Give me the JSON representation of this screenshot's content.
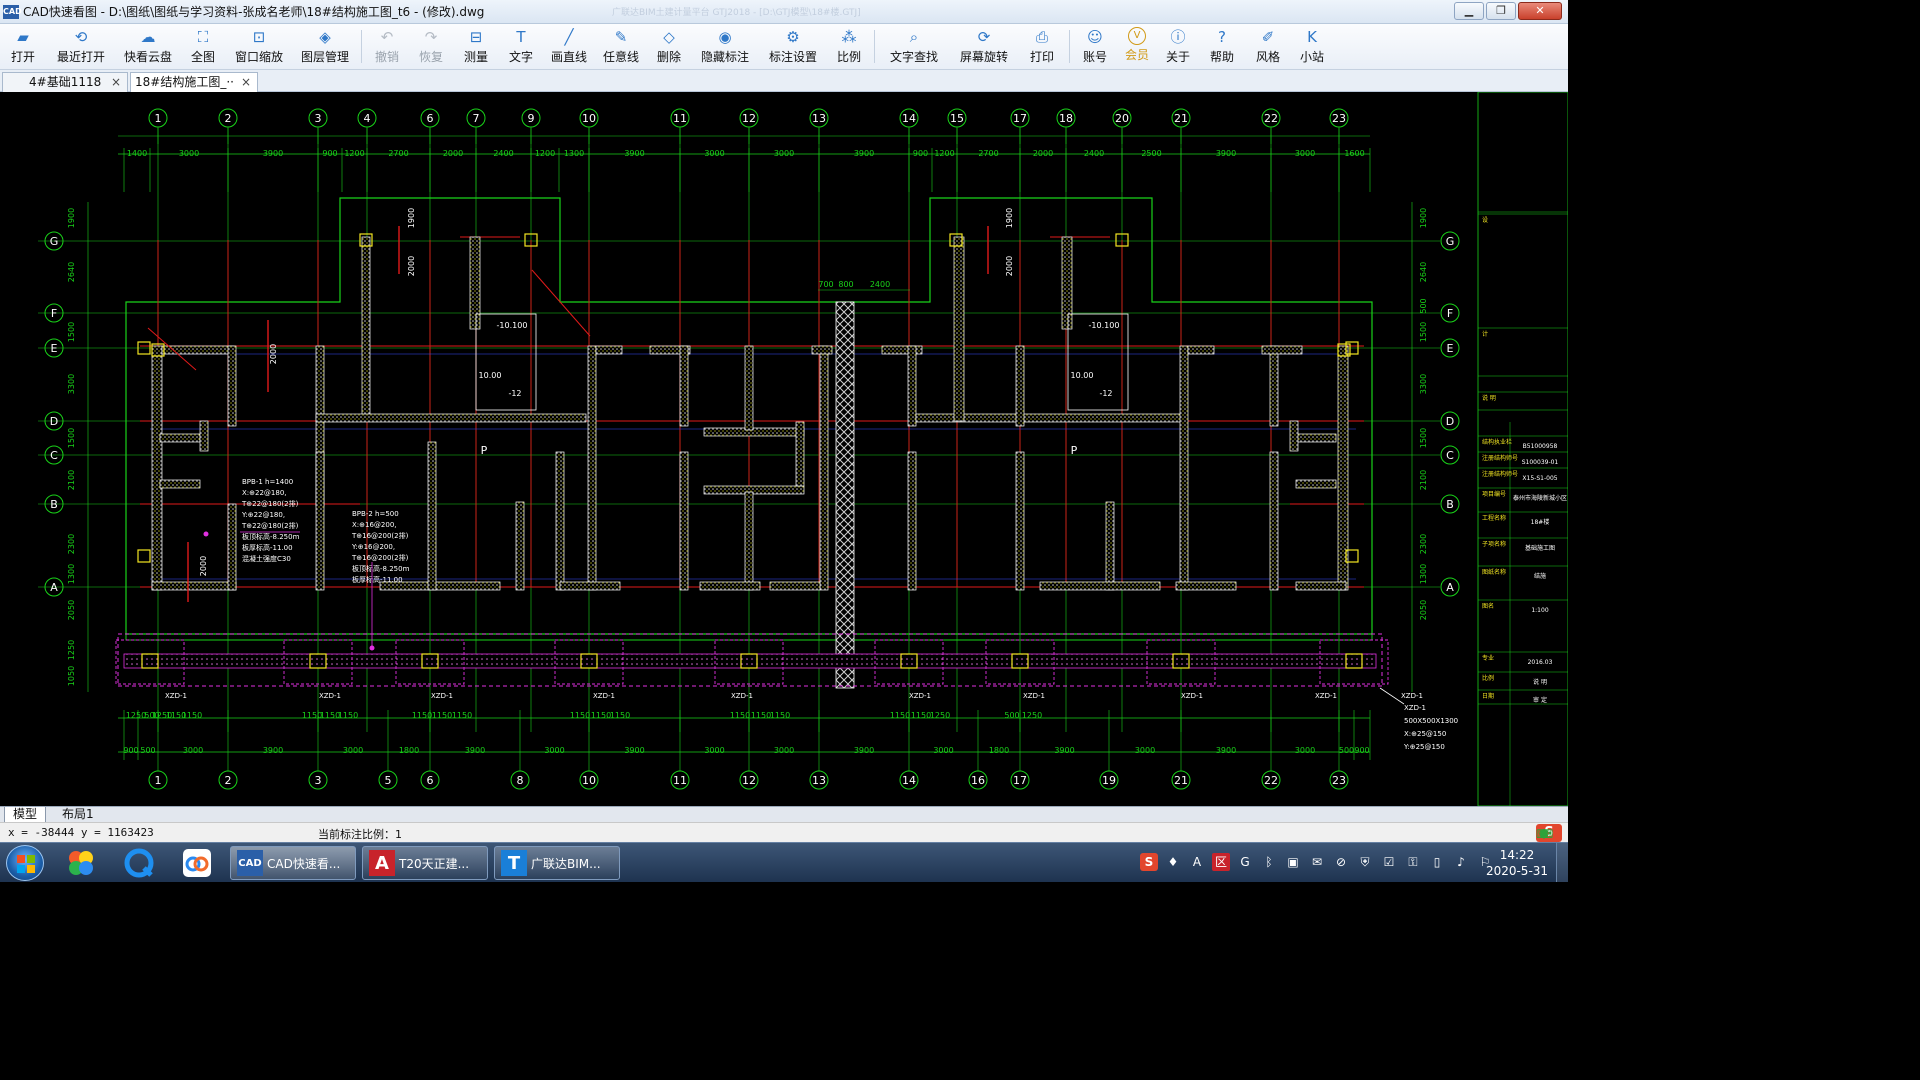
{
  "window": {
    "app_logo": "CAD",
    "title": "CAD快速看图 - D:\\图纸\\图纸与学习资料-张成名老师\\18#结构施工图_t6 - (修改).dwg",
    "faint_title": "广联达BIM土建计量平台 GTJ2018 - [D:\\GTJ模型\\18#楼.GTJ]",
    "minimize": "▁",
    "maximize": "❐",
    "close": "✕"
  },
  "toolbar": {
    "items": [
      {
        "id": "open",
        "label": "打开",
        "icon": "▰",
        "name": "open-folder-icon"
      },
      {
        "id": "recent",
        "label": "最近打开",
        "icon": "⟲",
        "name": "recent-clock-icon"
      },
      {
        "id": "cloud",
        "label": "快看云盘",
        "icon": "☁",
        "name": "cloud-icon"
      },
      {
        "id": "full",
        "label": "全图",
        "icon": "⛶",
        "name": "fullview-icon"
      },
      {
        "id": "zoom",
        "label": "窗口缩放",
        "icon": "⊡",
        "name": "window-zoom-icon"
      },
      {
        "id": "layers",
        "label": "图层管理",
        "icon": "◈",
        "name": "layers-icon",
        "sep_after": true
      },
      {
        "id": "undo",
        "label": "撤销",
        "icon": "↶",
        "name": "undo-icon",
        "disabled": true
      },
      {
        "id": "redo",
        "label": "恢复",
        "icon": "↷",
        "name": "redo-icon",
        "disabled": true
      },
      {
        "id": "measure",
        "label": "测量",
        "icon": "⊟",
        "name": "measure-ruler-icon"
      },
      {
        "id": "text",
        "label": "文字",
        "icon": "T",
        "name": "text-icon"
      },
      {
        "id": "line",
        "label": "画直线",
        "icon": "╱",
        "name": "draw-line-icon"
      },
      {
        "id": "freeline",
        "label": "任意线",
        "icon": "✎",
        "name": "freehand-line-icon"
      },
      {
        "id": "delete",
        "label": "删除",
        "icon": "◇",
        "name": "eraser-icon"
      },
      {
        "id": "hide",
        "label": "隐藏标注",
        "icon": "◉",
        "name": "hide-annotation-eye-icon"
      },
      {
        "id": "dimset",
        "label": "标注设置",
        "icon": "⚙",
        "name": "annotation-settings-icon"
      },
      {
        "id": "scale",
        "label": "比例",
        "icon": "⁂",
        "name": "scale-icon",
        "sep_after": true
      },
      {
        "id": "find",
        "label": "文字查找",
        "icon": "⌕",
        "name": "text-search-icon"
      },
      {
        "id": "rotate",
        "label": "屏幕旋转",
        "icon": "⟳",
        "name": "screen-rotate-icon"
      },
      {
        "id": "print",
        "label": "打印",
        "icon": "⎙",
        "name": "printer-icon",
        "sep_after": true
      },
      {
        "id": "account",
        "label": "账号",
        "icon": "☺",
        "name": "account-user-icon"
      },
      {
        "id": "vip",
        "label": "会员",
        "icon": "V",
        "name": "vip-badge-icon",
        "vip": true
      },
      {
        "id": "about",
        "label": "关于",
        "icon": "ⓘ",
        "name": "about-info-icon"
      },
      {
        "id": "help",
        "label": "帮助",
        "icon": "?",
        "name": "help-question-icon"
      },
      {
        "id": "style",
        "label": "风格",
        "icon": "✐",
        "name": "style-brush-icon"
      },
      {
        "id": "site",
        "label": "小站",
        "icon": "K",
        "name": "mini-site-icon"
      }
    ]
  },
  "tabs": [
    {
      "label": "4#基础1118",
      "active": false,
      "close": "×"
    },
    {
      "label": "18#结构施工图_··",
      "active": true,
      "close": "×"
    }
  ],
  "drawing": {
    "top_axes": [
      "1",
      "2",
      "3",
      "4",
      "6",
      "7",
      "9",
      "10",
      "11",
      "12",
      "13",
      "14",
      "15",
      "17",
      "18",
      "20",
      "21",
      "22",
      "23"
    ],
    "bottom_axes": [
      "1",
      "2",
      "3",
      "5",
      "6",
      "8",
      "10",
      "11",
      "12",
      "13",
      "14",
      "16",
      "17",
      "19",
      "21",
      "22",
      "23"
    ],
    "row_axes": [
      "G",
      "F",
      "E",
      "D",
      "C",
      "B",
      "A"
    ],
    "top_dims": [
      "1400",
      "3000",
      "3900",
      "900",
      "1200",
      "2700",
      "2000",
      "2400",
      "1200",
      "1300",
      "3900",
      "3000",
      "3000",
      "3900",
      "900",
      "1200",
      "2700",
      "2000",
      "2400",
      "2500",
      "3900",
      "3000",
      "1600"
    ],
    "bottom_dims": [
      "900",
      "500",
      "3000",
      "3900",
      "3000",
      "1800",
      "3900",
      "3000",
      "3900",
      "3000",
      "3000",
      "3900",
      "3000",
      "1800",
      "3900",
      "3000",
      "3900",
      "3000",
      "500",
      "900"
    ],
    "bottom_dims2": [
      "1250",
      "500",
      "1250",
      "1150",
      "1150",
      "1150",
      "1150",
      "1150",
      "1150",
      "1150",
      "1150",
      "1150",
      "1150",
      "1150",
      "1150",
      "1150",
      "1150",
      "1150",
      "1150",
      "1250",
      "500",
      "1250"
    ],
    "side_dims_left": [
      "1900",
      "2640",
      "1500",
      "3300",
      "1500",
      "2100",
      "2300",
      "1300",
      "2050",
      "1250",
      "1050"
    ],
    "side_dims_right": [
      "1900",
      "2640",
      "500",
      "1500",
      "3300",
      "1500",
      "2100",
      "2300",
      "1300",
      "2050"
    ],
    "mid_dims": [
      "700",
      "800",
      "2400"
    ],
    "tags": [
      "XZD-1",
      "XZD-1",
      "XZD-1",
      "XZD-1",
      "XZD-1",
      "XZD-1",
      "XZD-1",
      "XZD-1",
      "XZD-1",
      "XZD-1"
    ],
    "room_label": "P",
    "elev_labels": [
      "-10.100",
      "10.00",
      "-12",
      "-10.100",
      "10.00",
      "-12"
    ],
    "dim_2000": "2000",
    "dim_1900": "1900",
    "slab_note_1": [
      "BPB-1  h=1400",
      "X:⊕22@180,",
      "T⊕22@180(2排)",
      "Y:⊕22@180,",
      "T⊕22@180(2排)",
      "板顶标高-8.250m",
      "板厚标高-11.00",
      "混凝土强度C30"
    ],
    "slab_note_2": [
      "BPB-2  h=500",
      "X:⊕16@200,",
      "T⊕16@200(2排)",
      "Y:⊕16@200,",
      "T⊕16@200(2排)",
      "板顶标高-8.250m",
      "板厚标高-11.00"
    ],
    "right_note": [
      "XZD-1",
      "500X500X1300",
      "X:⊕25@150",
      "Y:⊕25@150"
    ],
    "title_block": {
      "rows": [
        "设",
        "计",
        "说  明",
        "结构执业栏",
        "注册结构师号",
        "注册结构师号",
        "项目编号",
        "工程名称",
        "子项名称",
        "图纸名称",
        "图名",
        "专业",
        "比例",
        "日期"
      ],
      "values": [
        "B51000958",
        "S100039-01",
        "X15-S1-005",
        "泰州市海陵新城小区",
        "18#楼",
        "基础施工图",
        "结施",
        "1:100",
        "2016.03",
        "说  明",
        "审  定"
      ]
    }
  },
  "layout_tabs": [
    "模型",
    "布局1"
  ],
  "status": {
    "coords": "x = -38444  y = 1163423",
    "scale_label": "当前标注比例：1",
    "ime": "S",
    "ime_icons": [
      "A",
      "☽",
      "♪",
      "⌨",
      "⚇",
      "♣",
      "▼",
      "⚘"
    ]
  },
  "taskbar": {
    "tasks": [
      {
        "label": "CAD快速看...",
        "icon": "CAD",
        "active": true
      },
      {
        "label": "T20天正建...",
        "icon": "A",
        "active": false
      },
      {
        "label": "广联达BIM...",
        "icon": "T",
        "active": false
      }
    ],
    "tray": [
      "S",
      "♦",
      "A",
      "区",
      "G",
      "ᛒ",
      "▣",
      "✉",
      "⊘",
      "⛨",
      "☑",
      "⚿",
      "▯",
      "♪",
      "⚐"
    ],
    "time": "14:22",
    "date": "2020-5-31"
  },
  "colors": {
    "grid": "#19d219",
    "dim": "#19d219",
    "beam": "#e01a1a",
    "wall": "#ffffff",
    "yellow": "#f2e522",
    "magenta": "#e030e0",
    "blue": "#3a4cff"
  }
}
